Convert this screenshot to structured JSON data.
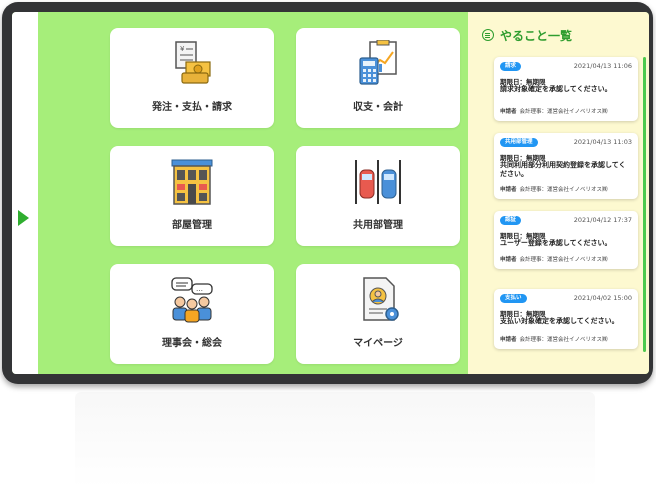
{
  "menu": {
    "tiles": [
      {
        "label": "発注・支払・請求",
        "icon": "invoice-money-icon"
      },
      {
        "label": "収支・会計",
        "icon": "calculator-chart-icon"
      },
      {
        "label": "部屋管理",
        "icon": "apartment-building-icon"
      },
      {
        "label": "共用部管理",
        "icon": "parking-cars-icon"
      },
      {
        "label": "理事会・総会",
        "icon": "meeting-people-icon"
      },
      {
        "label": "マイページ",
        "icon": "profile-document-icon"
      }
    ]
  },
  "todo": {
    "title": "やること一覧",
    "items": [
      {
        "badge": "請求",
        "date": "2021/04/13 11:06",
        "deadline": "期限日：無期限",
        "message": "請求対象確定を承認してください。",
        "applicant_label": "申請者",
        "applicant": "会計理事：運営会社イノベリオス㈱"
      },
      {
        "badge": "共用部管理",
        "date": "2021/04/13 11:03",
        "deadline": "期限日：無期限",
        "message": "共同利用部分利用契約登録を承認してください。",
        "applicant_label": "申請者",
        "applicant": "会計理事：運営会社イノベリオス㈱"
      },
      {
        "badge": "認証",
        "date": "2021/04/12 17:37",
        "deadline": "期限日：無期限",
        "message": "ユーザー登録を承認してください。",
        "applicant_label": "申請者",
        "applicant": "会計理事：運営会社イノベリオス㈱"
      },
      {
        "badge": "支払い",
        "date": "2021/04/02 15:00",
        "deadline": "期限日：無期限",
        "message": "支払い対象確定を承認してください。",
        "applicant_label": "申請者",
        "applicant": "会計理事：運営会社イノベリオス㈱"
      }
    ]
  },
  "colors": {
    "accent": "#2f9d2f",
    "menu_bg": "#a6ee7a",
    "todo_bg": "#fdf9d0",
    "badge": "#2196f3"
  }
}
